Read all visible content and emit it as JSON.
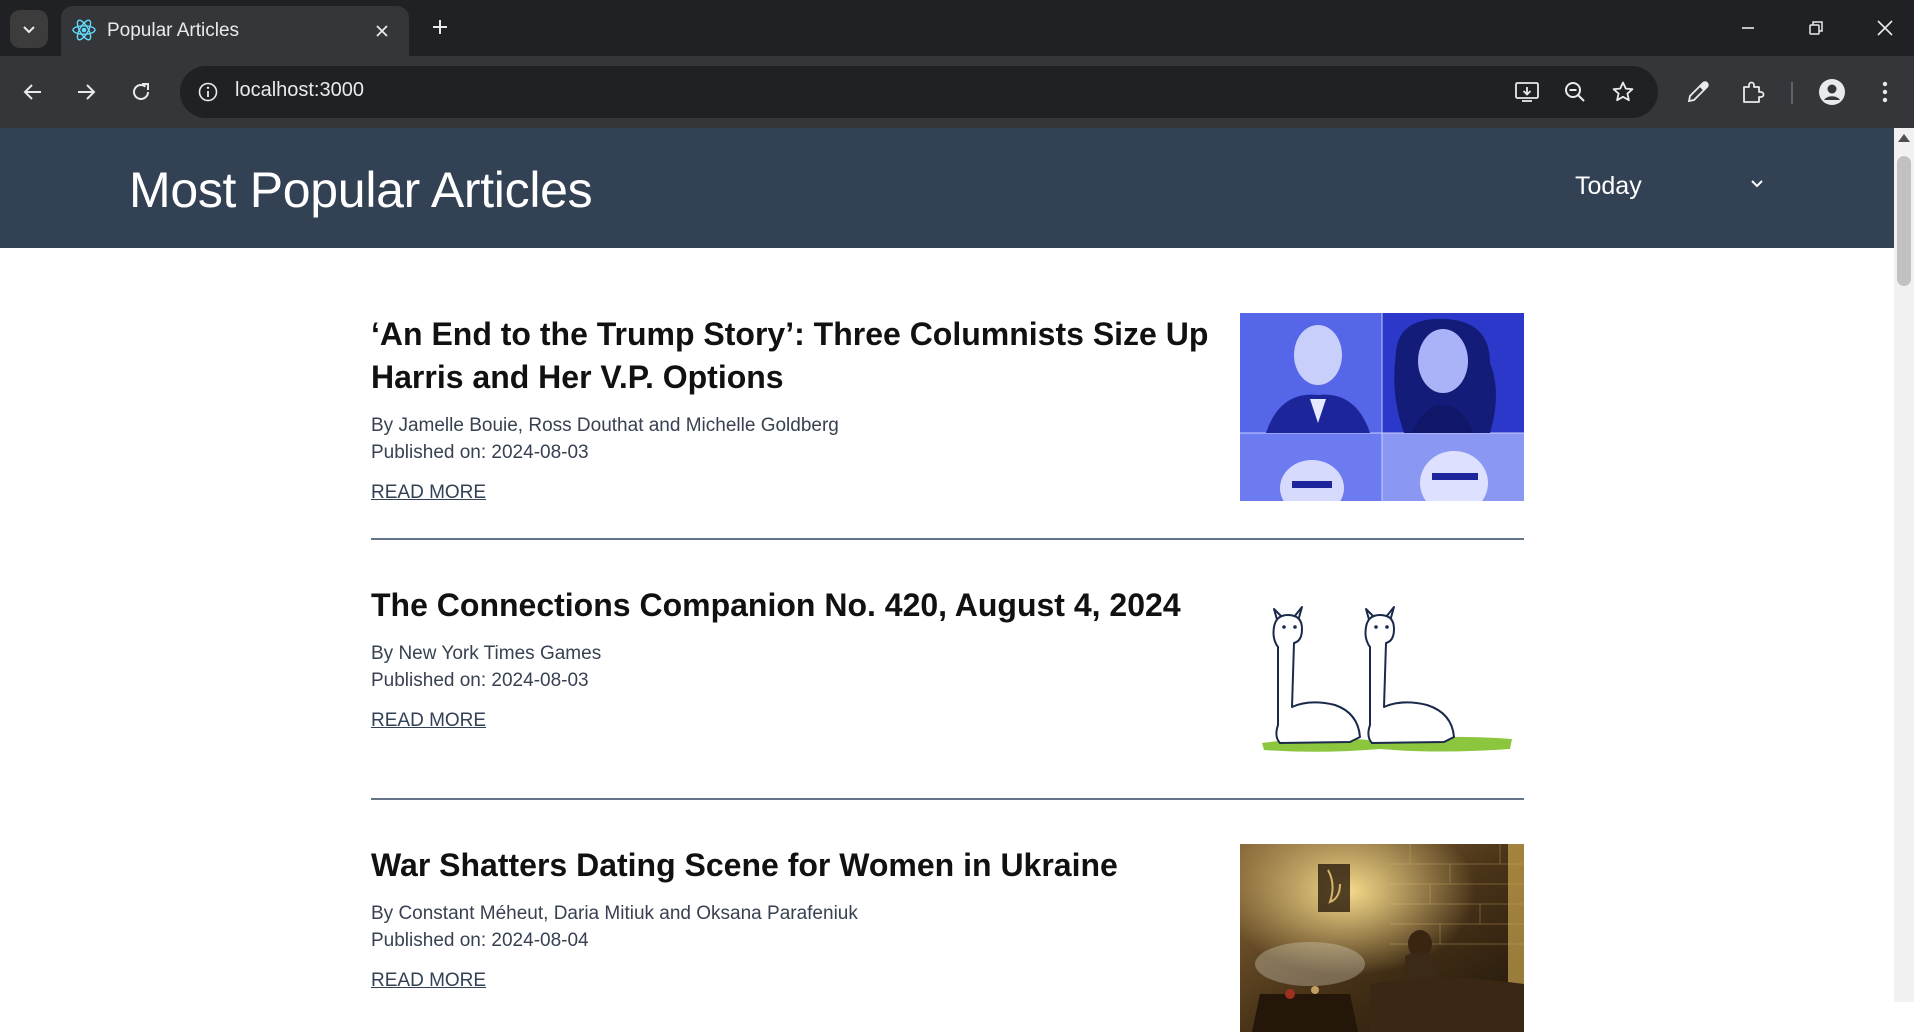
{
  "browser": {
    "tab_title": "Popular Articles",
    "url": "localhost:3000"
  },
  "header": {
    "title": "Most Popular Articles",
    "period_selected": "Today"
  },
  "articles": [
    {
      "title": "‘An End to the Trump Story’: Three Columnists Size Up Harris and Her V.P. Options",
      "byline": "By Jamelle Bouie, Ross Douthat and Michelle Goldberg",
      "published": "Published on: 2024-08-03",
      "read_more": "READ MORE"
    },
    {
      "title": "The Connections Companion No. 420, August 4, 2024",
      "byline": "By New York Times Games",
      "published": "Published on: 2024-08-03",
      "read_more": "READ MORE"
    },
    {
      "title": "War Shatters Dating Scene for Women in Ukraine",
      "byline": "By Constant Méheut, Daria Mitiuk and Oksana Parafeniuk",
      "published": "Published on: 2024-08-04",
      "read_more": "READ MORE"
    }
  ],
  "colors": {
    "header_bg": "#334155",
    "browser_dark": "#202124",
    "browser_tab": "#35363a",
    "divider": "#64748b",
    "photo_blue": "#4a5ae6"
  }
}
